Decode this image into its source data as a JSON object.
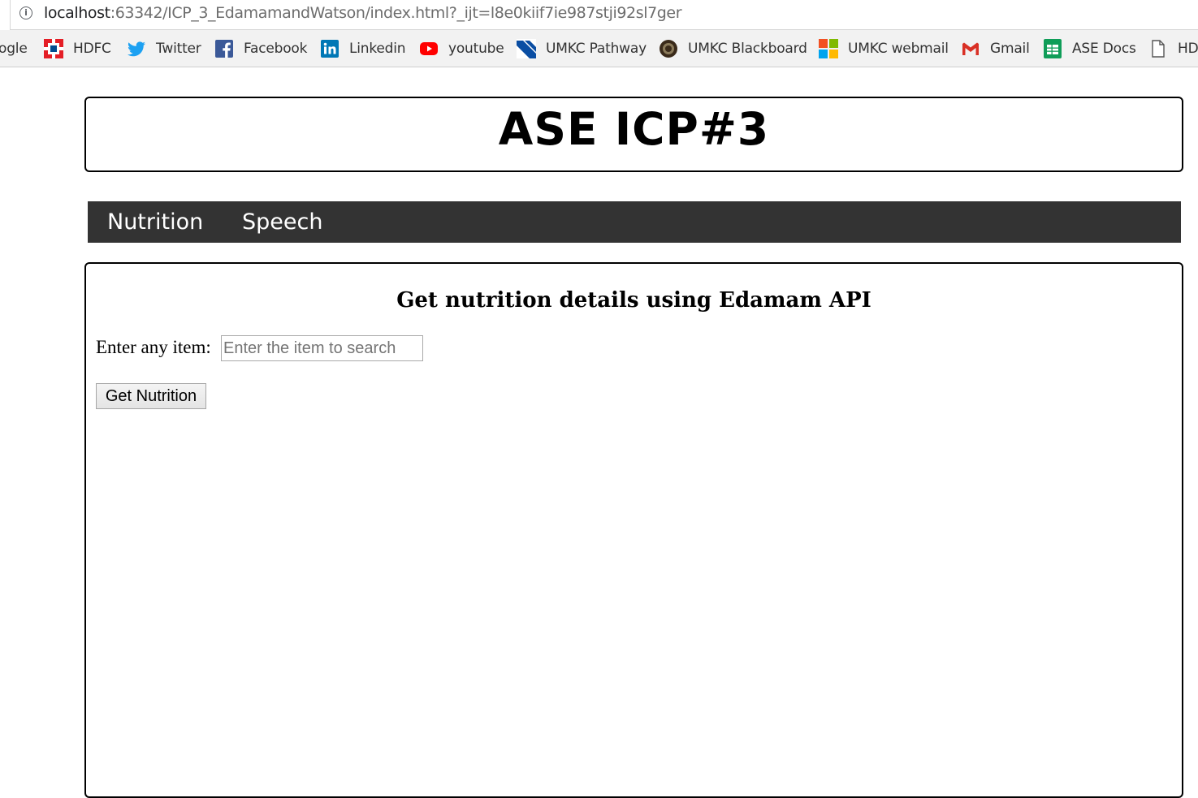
{
  "browser": {
    "url_host": "localhost",
    "url_rest": ":63342/ICP_3_EdamamandWatson/index.html?_ijt=l8e0kiif7ie987stji92sl7ger",
    "bookmarks": [
      {
        "label": "ogle",
        "icon": "google-icon"
      },
      {
        "label": "HDFC",
        "icon": "hdfc-icon"
      },
      {
        "label": "Twitter",
        "icon": "twitter-icon"
      },
      {
        "label": "Facebook",
        "icon": "facebook-icon"
      },
      {
        "label": "Linkedin",
        "icon": "linkedin-icon"
      },
      {
        "label": "youtube",
        "icon": "youtube-icon"
      },
      {
        "label": "UMKC Pathway",
        "icon": "umkc-pathway-icon"
      },
      {
        "label": "UMKC Blackboard",
        "icon": "blackboard-icon"
      },
      {
        "label": "UMKC webmail",
        "icon": "microsoft-icon"
      },
      {
        "label": "Gmail",
        "icon": "gmail-icon"
      },
      {
        "label": "ASE Docs",
        "icon": "sheets-icon"
      },
      {
        "label": "HD",
        "icon": "document-icon"
      }
    ]
  },
  "page": {
    "title": "ASE ICP#3",
    "nav": [
      {
        "label": "Nutrition"
      },
      {
        "label": "Speech"
      }
    ],
    "nutrition": {
      "heading": "Get nutrition details using Edamam API",
      "input_label": "Enter any item:",
      "input_placeholder": "Enter the item to search",
      "input_value": "",
      "button_label": "Get Nutrition"
    }
  },
  "colors": {
    "navbar_bg": "#333333",
    "bookmark_bar_bg": "#f2f2f2",
    "twitter": "#1da1f2",
    "facebook": "#3b5998",
    "linkedin": "#0077b5",
    "youtube": "#ff0000",
    "hdfc": "#e41e26"
  }
}
